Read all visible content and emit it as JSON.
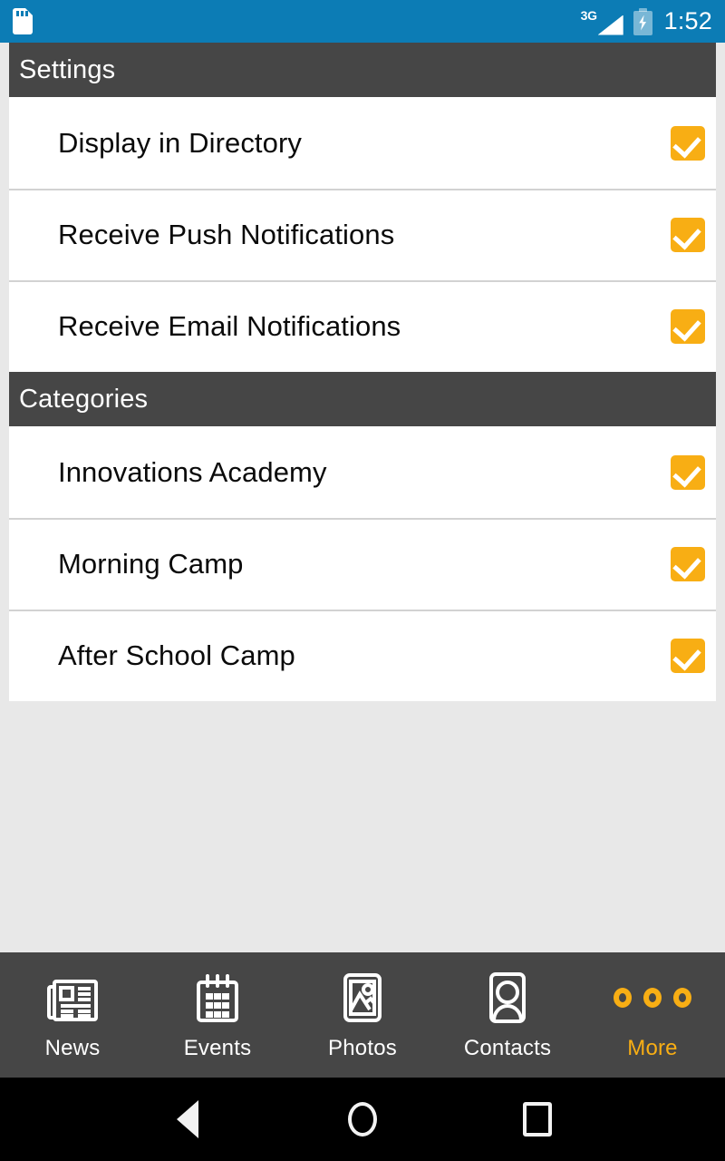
{
  "status_bar": {
    "sd_card_icon": "sd-card-icon",
    "network": "3G",
    "signal_icon": "signal-bars-icon",
    "battery_icon": "battery-charging-icon",
    "time": "1:52",
    "background_color": "#0c7cb5"
  },
  "theme": {
    "accent": "#f8ae14",
    "header_bar": "#464646",
    "page_background": "#e8e8e8",
    "row_background": "#ffffff"
  },
  "sections": [
    {
      "header": "Settings",
      "rows": [
        {
          "label": "Display in Directory",
          "checked": true
        },
        {
          "label": "Receive Push Notifications",
          "checked": true
        },
        {
          "label": "Receive Email Notifications",
          "checked": true
        }
      ]
    },
    {
      "header": "Categories",
      "rows": [
        {
          "label": "Innovations Academy",
          "checked": true
        },
        {
          "label": "Morning Camp",
          "checked": true
        },
        {
          "label": "After School Camp",
          "checked": true
        }
      ]
    }
  ],
  "tab_bar": [
    {
      "label": "News",
      "icon": "newspaper-icon",
      "active": false
    },
    {
      "label": "Events",
      "icon": "calendar-icon",
      "active": false
    },
    {
      "label": "Photos",
      "icon": "photo-icon",
      "active": false
    },
    {
      "label": "Contacts",
      "icon": "person-card-icon",
      "active": false
    },
    {
      "label": "More",
      "icon": "three-dots-icon",
      "active": true
    }
  ],
  "system_nav": {
    "back": "back-button",
    "home": "home-button",
    "recents": "recents-button"
  }
}
